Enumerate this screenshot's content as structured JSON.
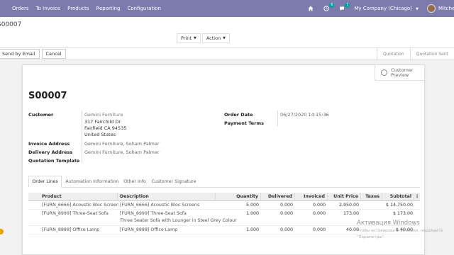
{
  "navbar": {
    "menu": [
      "Orders",
      "To Invoice",
      "Products",
      "Reporting",
      "Configuration"
    ],
    "activity_count": "6",
    "messages_count": "7",
    "company": "My Company (Chicago)",
    "user": "Mitchell A"
  },
  "control": {
    "breadcrumb": "S00007",
    "print_label": "Print",
    "action_label": "Action"
  },
  "statusbar": {
    "send_email_label": "Send by Email",
    "cancel_label": "Cancel",
    "stages": [
      "Quotation",
      "Quotation Sent"
    ]
  },
  "sheet": {
    "preview_label_1": "Customer",
    "preview_label_2": "Preview",
    "title": "S00007",
    "fields": {
      "customer_label": "Customer",
      "customer_name": "Gemini Furniture",
      "customer_street": "317 Fairchild Dr",
      "customer_city": "Fairfield CA 94535",
      "customer_country": "United States",
      "invoice_address_label": "Invoice Address",
      "invoice_address": "Gemini Furniture, Soham Palmer",
      "delivery_address_label": "Delivery Address",
      "delivery_address": "Gemini Furniture, Soham Palmer",
      "quotation_template_label": "Quotation Template",
      "order_date_label": "Order Date",
      "order_date": "06/27/2020 14:15:36",
      "payment_terms_label": "Payment Terms"
    },
    "tabs": [
      "Order Lines",
      "Automation Information",
      "Other Info",
      "Customer Signature"
    ],
    "table": {
      "headers": [
        "Product",
        "Description",
        "Quantity",
        "Delivered",
        "Invoiced",
        "Unit Price",
        "Taxes",
        "Subtotal"
      ],
      "rows": [
        {
          "product": "[FURN_6666] Acoustic Bloc Screens",
          "description": "[FURN_6666] Acoustic Bloc Screens",
          "description2": "",
          "quantity": "5.000",
          "delivered": "0.000",
          "invoiced": "0.000",
          "unit_price": "2,950.00",
          "taxes": "",
          "subtotal": "$ 14,750.00"
        },
        {
          "product": "[FURN_8999] Three-Seat Sofa",
          "description": "[FURN_8999] Three-Seat Sofa",
          "description2": "Three Seater Sofa with Lounger in Steel Grey Colour",
          "quantity": "1.000",
          "delivered": "0.000",
          "invoiced": "0.000",
          "unit_price": "173.00",
          "taxes": "",
          "subtotal": "$ 173.00"
        },
        {
          "product": "[FURN_8888] Office Lamp",
          "description": "[FURN_8888] Office Lamp",
          "description2": "",
          "quantity": "1.000",
          "delivered": "0.000",
          "invoiced": "0.000",
          "unit_price": "40.00",
          "taxes": "",
          "subtotal": "$ 40.00"
        }
      ]
    }
  },
  "watermark": {
    "line1": "Активация Windows",
    "line2": "Чтобы активировать Windows, перейдите",
    "line3": "\"Параметры\"."
  }
}
